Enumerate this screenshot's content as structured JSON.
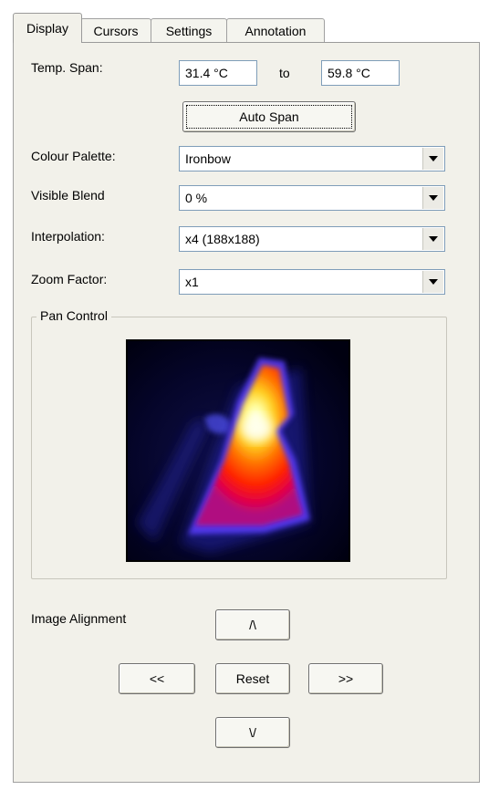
{
  "tabs": [
    {
      "label": "Display",
      "active": true
    },
    {
      "label": "Cursors",
      "active": false
    },
    {
      "label": "Settings",
      "active": false
    },
    {
      "label": "Annotation",
      "active": false
    }
  ],
  "temp_span": {
    "label": "Temp. Span:",
    "min_value": "31.4 °C",
    "to_label": "to",
    "max_value": "59.8 °C",
    "auto_span_label": "Auto Span"
  },
  "colour_palette": {
    "label": "Colour Palette:",
    "value": "Ironbow"
  },
  "visible_blend": {
    "label": "Visible Blend",
    "value": "0 %"
  },
  "interpolation": {
    "label": "Interpolation:",
    "value": "x4 (188x188)"
  },
  "zoom_factor": {
    "label": "Zoom Factor:",
    "value": "x1"
  },
  "pan_control": {
    "title": "Pan Control"
  },
  "image_alignment": {
    "label": "Image Alignment",
    "up_label": "/\\",
    "left_label": "<<",
    "reset_label": "Reset",
    "right_label": ">>",
    "down_label": "\\/"
  },
  "colors": {
    "panel_bg": "#f2f1ea",
    "field_border": "#7f9db9",
    "thermal_cold": "#000010",
    "thermal_hot": "#ffffe0"
  }
}
